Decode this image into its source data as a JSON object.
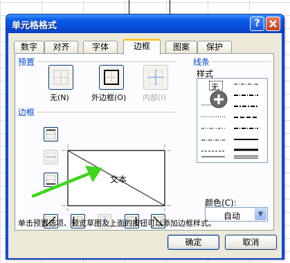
{
  "window": {
    "title": "单元格格式",
    "help_label": "?",
    "close_label": "✕"
  },
  "tabs": [
    {
      "label": "数字"
    },
    {
      "label": "对齐"
    },
    {
      "label": "字体"
    },
    {
      "label": "边框",
      "active": true
    },
    {
      "label": "图案"
    },
    {
      "label": "保护"
    }
  ],
  "presets": {
    "group_label": "预置",
    "none_label": "无(N)",
    "outline_label": "外边框(O)",
    "inside_label": "内部(I)"
  },
  "border": {
    "group_label": "边框",
    "preview_text": "文本"
  },
  "line": {
    "group_label": "线条",
    "style_label": "样式",
    "none_style_label": "无",
    "color_label": "颜色(C):",
    "color_value": "自动"
  },
  "hint_text": "单击预置选项、预览草图及上面的按钮可以添加边框样式。",
  "buttons": {
    "ok": "确定",
    "cancel": "取消"
  },
  "overlay": {
    "pointer_arrow_color": "#3fd51e",
    "cursor_icon": "plus-cursor-icon"
  }
}
